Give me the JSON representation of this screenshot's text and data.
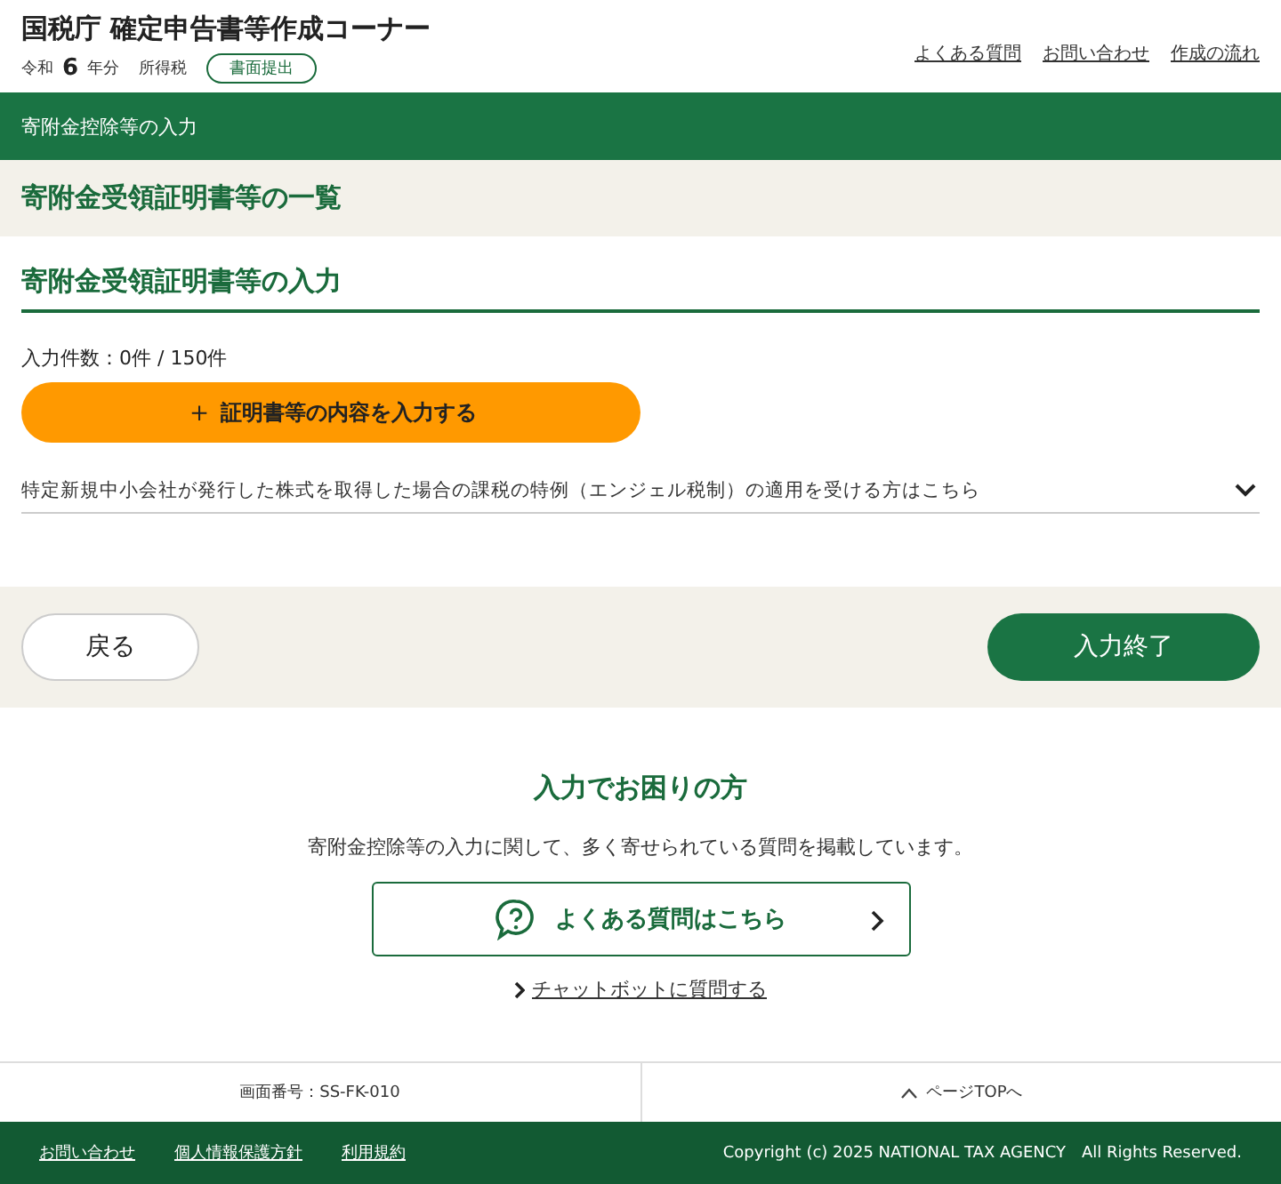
{
  "header": {
    "title": "国税庁 確定申告書等作成コーナー",
    "era": "令和",
    "year": "6",
    "year_suffix": "年分",
    "tax": "所得税",
    "badge": "書面提出",
    "links": [
      "よくある質問",
      "お問い合わせ",
      "作成の流れ"
    ]
  },
  "section_bar": {
    "title": "寄附金控除等の入力"
  },
  "page_title": "寄附金受領証明書等の一覧",
  "input_section": {
    "heading": "寄附金受領証明書等の入力",
    "count": "入力件数：0件 / 150件",
    "add_button": {
      "icon": "＋",
      "label": "証明書等の内容を入力する"
    },
    "accordion": {
      "label": "特定新規中小会社が発行した株式を取得した場合の課税の特例（エンジェル税制）の適用を受ける方はこちら",
      "expanded": false
    }
  },
  "nav": {
    "back": "戻る",
    "finish": "入力終了"
  },
  "help": {
    "title": "入力でお困りの方",
    "text": "寄附金控除等の入力に関して、多く寄せられている質問を掲載しています。",
    "faq_button": "よくある質問はこちら",
    "chat_link": "チャットボットに質問する"
  },
  "footer_bar": {
    "screen_id": "画面番号：SS-FK-010",
    "page_top": "ページTOPへ"
  },
  "footer": {
    "links": [
      "お問い合わせ",
      "個人情報保護方針",
      "利用規約"
    ],
    "copyright": "Copyright (c) 2025 NATIONAL TAX AGENCY　All Rights Reserved."
  }
}
